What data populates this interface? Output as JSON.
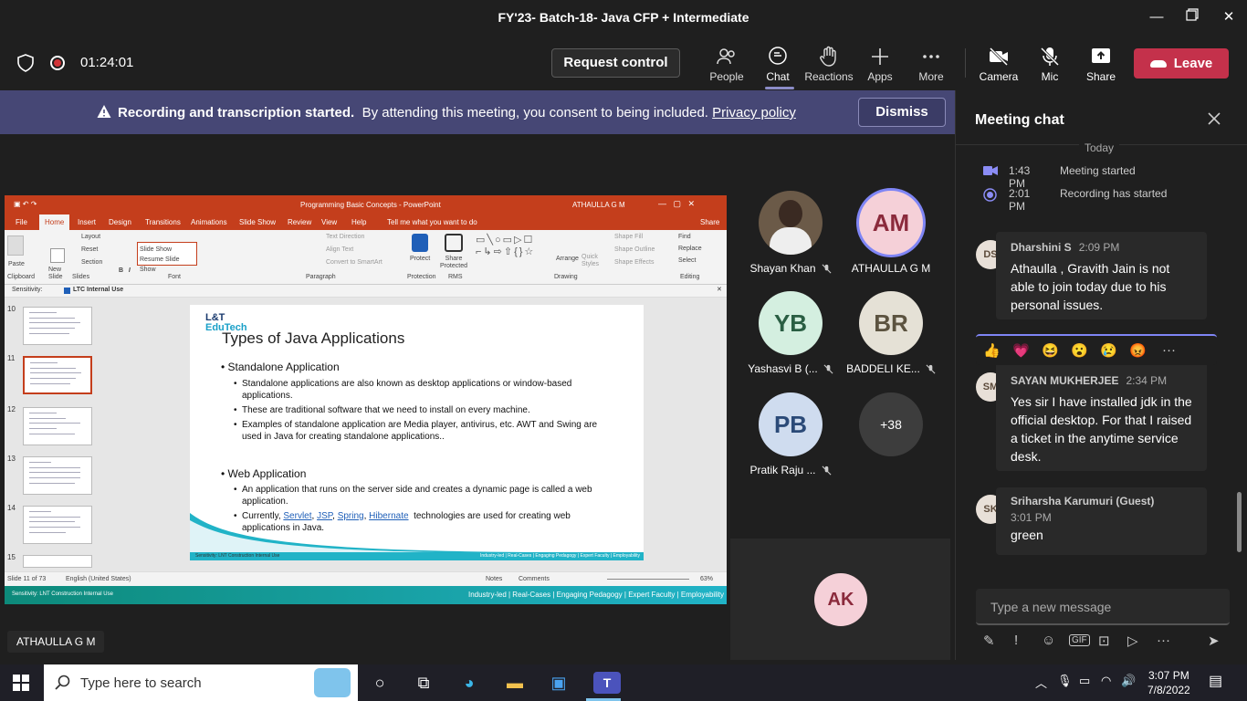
{
  "window": {
    "title": "FY'23- Batch-18- Java CFP + Intermediate"
  },
  "toolbar": {
    "timer": "01:24:01",
    "request_control": "Request control",
    "people": "People",
    "chat": "Chat",
    "reactions": "Reactions",
    "apps": "Apps",
    "more": "More",
    "camera": "Camera",
    "mic": "Mic",
    "share": "Share",
    "leave": "Leave"
  },
  "banner": {
    "bold": "Recording and transcription started.",
    "text": "By attending this meeting, you consent to being included.",
    "link": "Privacy policy",
    "dismiss": "Dismiss"
  },
  "ppt": {
    "title": "Programming Basic Concepts - PowerPoint",
    "user": "ATHAULLA G M",
    "tabs": [
      "File",
      "Home",
      "Insert",
      "Design",
      "Transitions",
      "Animations",
      "Slide Show",
      "Review",
      "View",
      "Help",
      "Tell me what you want to do",
      "Share"
    ],
    "ribbon": {
      "layout": "Layout",
      "reset": "Reset",
      "section": "Section",
      "paste": "Paste",
      "new_slide": "New Slide",
      "clipboard": "Clipboard",
      "slides": "Slides",
      "font": "Font",
      "paragraph": "Paragraph",
      "protection": "Protection",
      "rms": "RMS",
      "drawing": "Drawing",
      "editing": "Editing",
      "find": "Find",
      "replace": "Replace",
      "select": "Select",
      "protect": "Protect",
      "share_protected": "Share Protected",
      "arrange": "Arrange",
      "quick_styles": "Quick Styles",
      "font_box1": "Slide Show",
      "font_box2": "Resume Slide Show",
      "text_direction": "Text Direction",
      "align_text": "Align Text",
      "convert_smartart": "Convert to SmartArt",
      "shape_fill": "Shape Fill",
      "shape_outline": "Shape Outline",
      "shape_effects": "Shape Effects"
    },
    "sensitivity_label": "Sensitivity:",
    "sensitivity_value": "LTC Internal Use",
    "thumb_numbers": [
      "10",
      "11",
      "12",
      "13",
      "14",
      "15"
    ],
    "status_slide": "Slide 11 of 73",
    "status_lang": "English (United States)",
    "status_notes": "Notes",
    "status_comments": "Comments",
    "zoom": "63%",
    "footer_left": "Sensitivity: LNT Construction Internal Use",
    "footer_right": "Industry-led  |  Real-Cases  |  Engaging Pedagogy  |  Expert Faculty  |  Employability"
  },
  "slide": {
    "logo_top": "L&T",
    "logo_bottom": "EduTech",
    "title": "Types of Java Applications",
    "h1": "Standalone Application",
    "s1": "Standalone applications are also known as desktop applications or window-based applications.",
    "s2": "These are traditional software that we need to install on every machine.",
    "s3": "Examples of standalone application are Media player, antivirus, etc. AWT and Swing are used in Java for creating standalone applications..",
    "h2": "Web Application",
    "w1": "An application that runs on the server side and creates a dynamic page is called a web application.",
    "w2_pre": "Currently,",
    "w2_l1": "Servlet",
    "w2_l2": "JSP",
    "w2_l3": "Spring",
    "w2_l4": "Hibernate",
    "w2_post": "technologies are used for creating web applications in Java.",
    "foot_left": "Sensitivity: LNT Construction Internal Use",
    "foot_right": "Industry-led | Real-Cases | Engaging Pedagogy | Expert Faculty | Employability"
  },
  "presenter_badge": "ATHAULLA G M",
  "participants": [
    {
      "name": "Shayan Khan",
      "initials": "",
      "bg": "#6b5a48",
      "fg": "#fff"
    },
    {
      "name": "ATHAULLA G M",
      "initials": "AM",
      "bg": "#f5d0d8",
      "fg": "#8b2a3c"
    },
    {
      "name": "Yashasvi B (...",
      "initials": "YB",
      "bg": "#d4efe0",
      "fg": "#2a5e43"
    },
    {
      "name": "BADDELI KE...",
      "initials": "BR",
      "bg": "#e5e1d6",
      "fg": "#5c5340"
    },
    {
      "name": "Pratik Raju ...",
      "initials": "PB",
      "bg": "#cfdcef",
      "fg": "#2b4a78"
    },
    {
      "name": "",
      "initials": "+38",
      "bg": "#3d3d3d",
      "fg": "#fff"
    }
  ],
  "self_view": {
    "initials": "AK"
  },
  "chat": {
    "header": "Meeting chat",
    "today": "Today",
    "sys1_time": "1:43 PM",
    "sys1_text": "Meeting started",
    "sys2_time": "2:01 PM",
    "sys2_text": "Recording has started",
    "messages": [
      {
        "initials": "DS",
        "sender": "Dharshini S",
        "time": "2:09 PM",
        "text": "Athaulla , Gravith Jain is not able to join today due to his personal issues."
      },
      {
        "initials": "SM",
        "sender": "SAYAN MUKHERJEE",
        "time": "2:34 PM",
        "text": "Yes sir I have installed jdk in the official desktop. For that I raised a ticket in the anytime service desk."
      },
      {
        "initials": "SK",
        "sender": "Sriharsha Karumuri (Guest)",
        "time": "3:01 PM",
        "text": "green"
      }
    ],
    "reactions": [
      "👍",
      "💗",
      "😆",
      "😮",
      "😢",
      "😡",
      "···"
    ],
    "placeholder": "Type a new message"
  },
  "taskbar": {
    "search_placeholder": "Type here to search",
    "time": "3:07 PM",
    "date": "7/8/2022"
  }
}
